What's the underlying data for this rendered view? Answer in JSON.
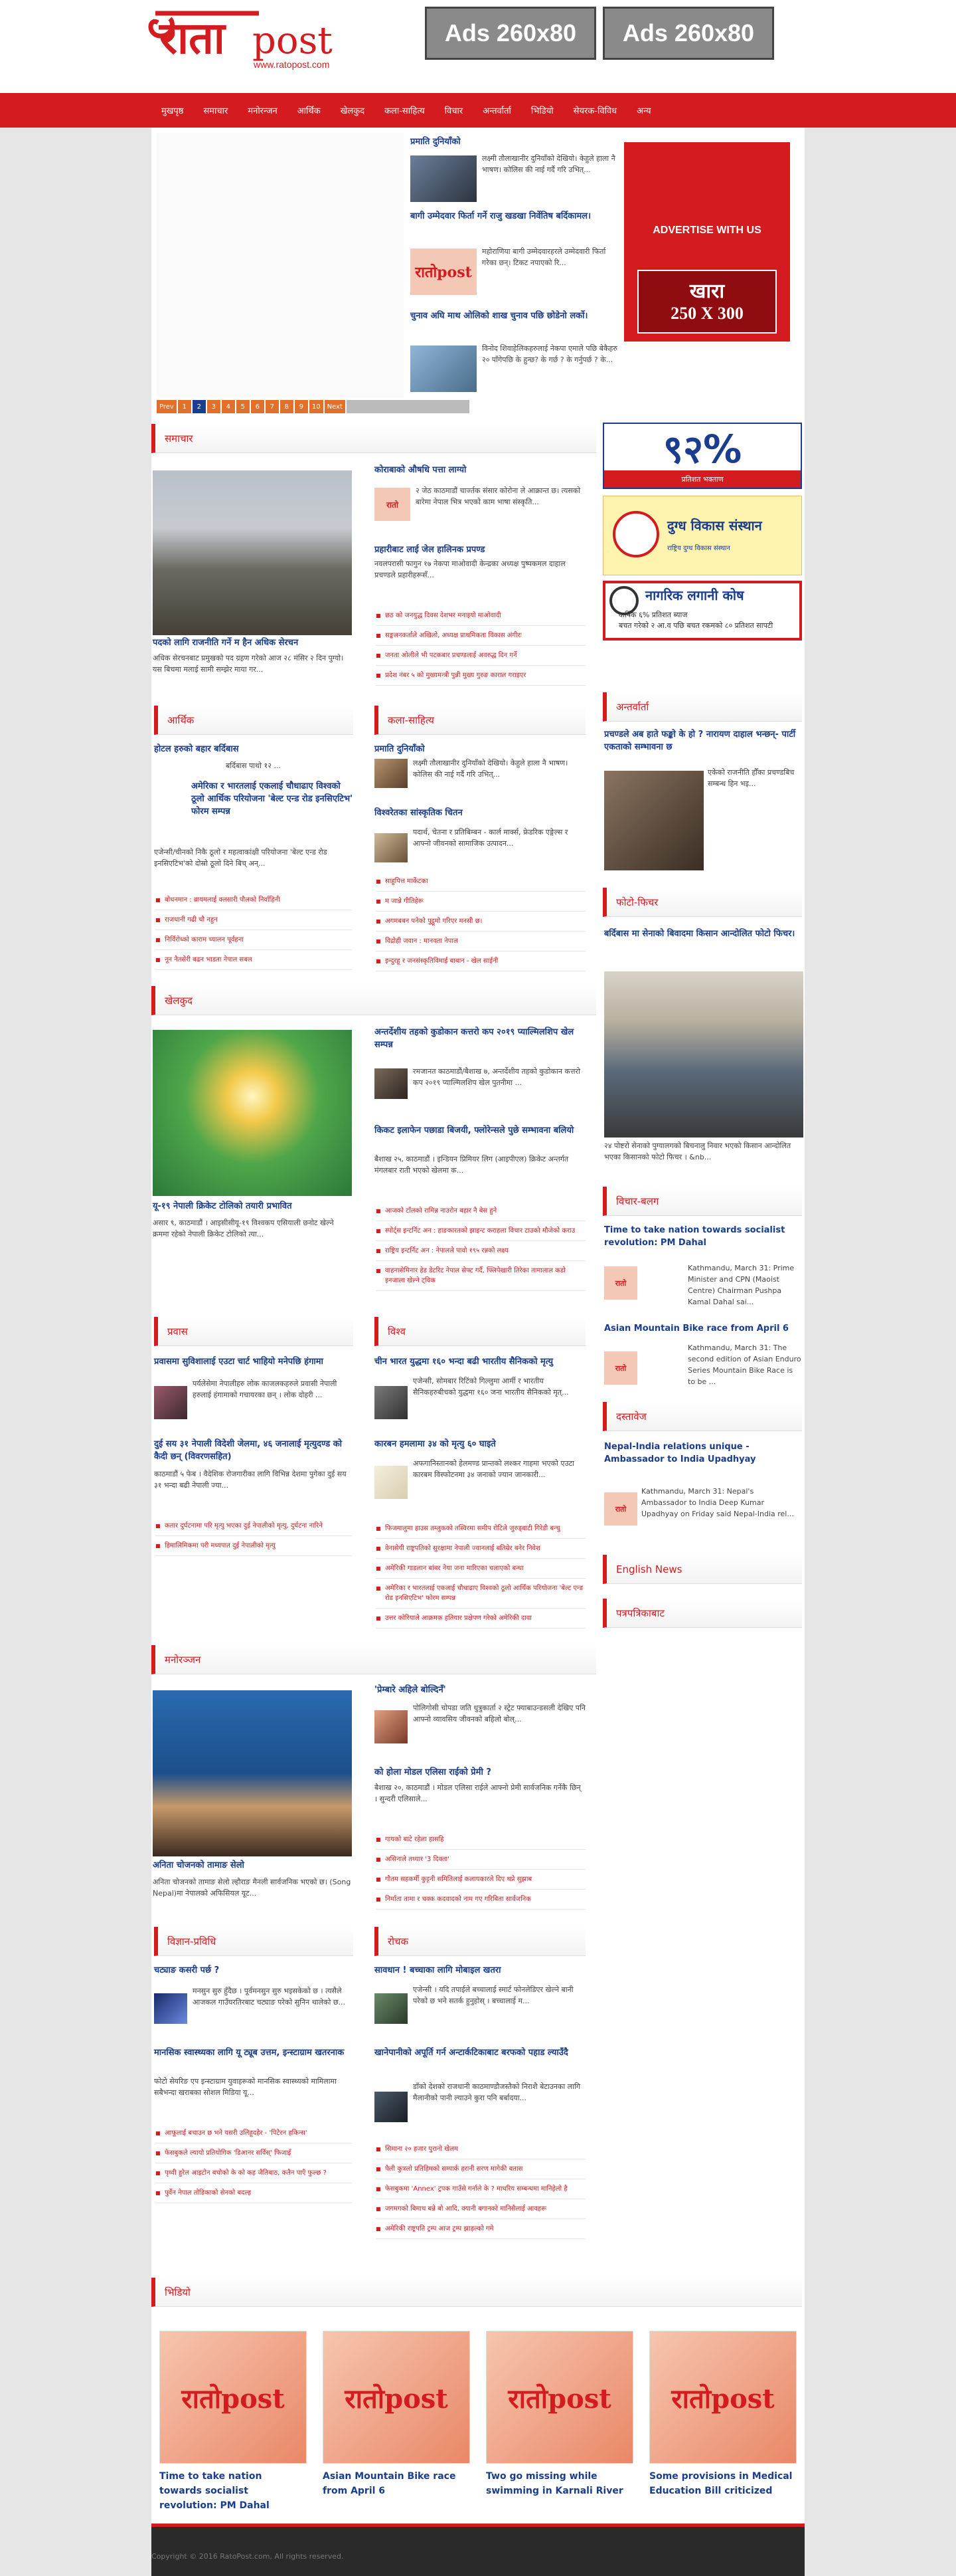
{
  "brand": {
    "logo_main": "रातोpost",
    "logo_url": "www.ratopost.com",
    "colors": {
      "red": "#d41b1f",
      "blue": "#1a3d8f"
    }
  },
  "header": {
    "ad1": "Ads 260x80",
    "ad2": "Ads 260x80"
  },
  "nav": [
    "मुखपृष्ठ",
    "समाचार",
    "मनोरन्जन",
    "आर्थिक",
    "खेलकुद",
    "कला-साहित्य",
    "विचार",
    "अन्तर्वार्ता",
    "भिडियो",
    "सेयरक-विविध",
    "अन्य"
  ],
  "slider": {
    "items": [
      {
        "title": "प्रमाति दुनियाँको",
        "text": "लक्ष्मी तौलाखानीर दुनियाँको देखियो। केहुले हाला नै भाषण। कोलिस की नाई गर्दै गरि उभित्..."
      },
      {
        "title": "बागी उम्मेदवार फिर्ता गर्ने राजु खडखा निर्वेतिष बर्दिकामल।",
        "text": "महोराणिया बागी उम्मेदवारहरले उम्मेदवारी फिर्ता गरेका छन्। टिकट नपाएको रि..."
      },
      {
        "title": "चुनाव अघि माथ ओलिको शाख चुनाव पछि छोडेनो लर्को।",
        "text": "विनोद शिवाहेलिकहरुलाई नेकपा एमाले पछि बेकैहरु २० पाँगेपछि के हुन्छ? के गर्छ ? के गर्नुपर्छ ? के..."
      }
    ],
    "pager": [
      "Prev",
      "1",
      "2",
      "3",
      "4",
      "5",
      "6",
      "7",
      "8",
      "9",
      "10",
      "Next"
    ]
  },
  "side_ad": {
    "top": "ADVERTISE WITH US",
    "main": "खारा",
    "size": "250 X 300"
  },
  "side_banners": {
    "pct": "९२%",
    "pct_sub": "प्रतिशत भक्ताण",
    "dairy": "दुग्ध विकास संस्थान",
    "dairy_sub": "राष्ट्रिय दुग्ध विकास संस्थान",
    "kosh": "नागरिक लगानी कोष",
    "kosh_line1": "वार्षिक ६% प्रतिशत ब्याज",
    "kosh_line2": "बचत गरेको २ आ.व पछि बचत रकमको ८० प्रतिशत सापटी"
  },
  "samachar": {
    "title": "समाचार",
    "lead_title": "पदको लागि राजनीति गर्ने म हैन अधिक सेरचन",
    "lead_text": "अधिक सेरचनबाट प्रमुखको पद ग्रहण गरेको आज २८ मंसिर २ दिन पुग्यो। यस बिचमा मलाई सामी सम्झेर माया गर...",
    "right_title": "कोराबाको औषधि पत्ता लाग्यो",
    "right_text": "२ जेठ काठमाडौं चार्ज्तक संसार कोरोना ले आक्रान्त छ। त्यसको बारेमा नेपाल भित्र भएको काम भाषा संस्कृति...",
    "right2_title": "प्रहारीबाट लाई जेल हालिनक प्रपण्ड",
    "right2_text": "नवलपरासी फागुन १७ नेकपा माओवादी केन्द्रका अध्यक्ष पुष्पकमल दाहाल प्रचण्डले प्रहारीहरूसँ...",
    "list": [
      "छठ को जनयुद्ध दिवस देशभर मनाइयो माओवादी",
      "सङ्कलनकर्ताले अखिलो, अध्यक्ष प्राथमिकता विकास अंगीरः",
      "जनता ओलीले भी पटकबार प्रचण्डलाई अवरुद्ध दिन गर्ने",
      "प्रदेश नंबर ५ को मुख्यमन्त्री पुन्नी मुख्य गुरुङ काराल गराइएर"
    ]
  },
  "arthik": {
    "title": "आर्थिक",
    "item1_title": "होटल हरुको बहार बर्दिबास",
    "item1_text": "बर्दिबास पाथो १२ ...",
    "item2_title": "अमेरिका र भारतलाई एकलाई चौधाढाए विश्वको ठूलो आर्थिक परियोजना 'बेल्ट एन्ड रोड इनसिएटिभ' फोरम सम्पन्न",
    "item2_text": "एजेन्सी/चीनको निकै ठूलो र महत्वाकांक्षी परियोजना 'बेल्ट एन्ड रोड इनसिएटिभ'को दोस्रो ठूलो दिने बिच् अन्...",
    "list": [
      "बोधनमान : ब्रायमलाई क्लसारी पौलको निर्वाहिनी",
      "राजधानी गढी चौ नहुन",
      "निर्विरोध्को काराम च्यालन पूर्वहना",
      "नून नैतसेरी बढन भाडता नेपाल सबल"
    ]
  },
  "kala": {
    "title": "कला-साहित्य",
    "item1_title": "प्रमाति दुनियाँको",
    "item1_text": "लक्ष्मी तौलाखानीर दुनियाँको देखियो। केहुले हाला नै भाषण। कोलिस की नाई गर्दै गरि उभित्...",
    "item2_title": "विश्वरेतका सांस्कृतिक चितन",
    "item2_text": "पदार्थ, चेतना र प्रतिबिम्बन - कार्ल मार्क्स, फ्रेडरिक एङ्गेल्स र आफ्नो जीवनको सामाजिक उत्पादन...",
    "list": [
      "साहुपित्त मार्केटका",
      "म जान्ने गीतिहेरू",
      "अगमबबन पनेको पुट्ठूमो गरिएर मनसी छ।",
      "विद्रोही जवान : मानवता नेपाल",
      "इन्दुरहू र जनसंस्कृतिविमाई बाबान - खेल साईनी"
    ]
  },
  "antarbarta": {
    "title": "अन्तर्वार्ता",
    "lead_title": "प्रचण्डले अब हाते फङ्को के हो ? नारायण दाहाल भन्छन्- पार्टी एकताको सम्भावना छ",
    "text": "एकेको राजनीति हौँका प्रचण्डबिच सम्बन्ध हिन भइ..."
  },
  "photo_feature": {
    "title": "फोटो-फिचर",
    "lead_title": "बर्दिबास मा सेनाको बिवादमा किसान आन्दोलित फोटो फिचर।",
    "text": "२४ पोष्टरो सेनाको पुग्यालगको बिचनालु निवार भएको किसान आन्दोलित भएका किसानको फोटो फिचर । &nb..."
  },
  "khelkud": {
    "title": "खेलकुद",
    "lead_title": "यू-१९ नेपाली क्रिकेट टोलिको तयारी प्रभावित",
    "lead_text": "असार ९, काठमाडौं । आइसीसीयू-१९ विश्वकप एसियाली छनोट खेल्ने क्रममा रहेको नेपाली क्रिकेट टोलिको त्या...",
    "item1_title": "अन्तर्देशीय तहको कुडोकान कत्तरो कप २०१९ प्याल्मिलशिप खेल सम्पन्न",
    "item1_text": "रमजानत काठमाडौं/बैशाख ७, अन्तर्देशीय तहको कुडोकान कत्तरो कप २०१९ प्याल्मिलशिप खेल पुतनीमा ...",
    "item2_title": "किकट इलाफेन पछाडा बिजयी, फ्लोरेन्सले पुछे सम्भावना बलियो",
    "item2_text": "बैशाख २५, काठमाडौं । इन्डियन प्रिमियर लिग (आइपीएल) क्रिकेट अन्तर्गत मंगलबार राती भएको खेलमा क...",
    "list": [
      "आजको टाँलको रामिन्न नाउरोन बहार नै बेस हुने",
      "स्पोर्ट्स इन्टर्निट अन : हाङकारतको झाइन्ट कराहला विचार टाउको मौजेको कराउ",
      "राष्ट्रिय इन्टर्निट अन : नेपालले पावो १९५ रन्नको लक्ष्य",
      "वाहनासेमिनार हेड डेटरिट नेपाल सेफ्ट गर्दै, फ्लिपेखारी तिरेका तामालाल कडो इनजाला खेल्ने ट्विक"
    ]
  },
  "prabas": {
    "title": "प्रवास",
    "item1_title": "प्रवासमा सुविशालाई एउटा चार्ट भाहियो मनेपछि हंगामा",
    "item1_text": "पर्यलेसेमा नेपालीहरु लोक काजलकहरुले प्रवासी नेपाली हरुलाई हंगामाको गचायरका छन् । लोक दोहरी ...",
    "item2_title": "दुई सय ३१ नेपाली विदेशी जेलमा, ४६ जनालाई मृत्युदण्ड को कैदी छन् (विवरणसहित)",
    "item2_text": "काठमाडौं ५ फेब । वैदेशिक रोजगारीका लागि विभिन्न देशमा पुगेका दुई सय ३१ भन्दा बढी नेपाली ज्या...",
    "list": [
      "कतार दुर्घटनामा परि मृत्यु भएका दुई नेपालीको मृत्यु, दुर्घटना नारिने",
      "हिमालिमिकमा परी मध्यपात दुई नेपालीको मृत्यु"
    ]
  },
  "bishwa": {
    "title": "विश्व",
    "item1_title": "चीन भारत युद्धमा १६० भन्दा बढी भारतीय सैनिकको मृत्यु",
    "item1_text": "एजेन्सी, सोमबार रिटिंको गिल्लुमा आर्मी र भारतीय सैनिकहरुबीचको युद्धमा १६० जना भारतीय सैनिकको मृत्...",
    "item2_title": "कारबन हमलामा ३४ को मृत्यु ६० घाइते",
    "item2_text": "अफगानिस्तानको हेलमण्ड प्रान्तको लश्कर गाहमा भएको एउटा कारबम विस्फोटनमा ३४ जनाको ज्यान जानकारी...",
    "list": [
      "फिजमालुमा हाउस तम्लुकको तस्विरमा समीप रोटिले जुरुड्बाटी गिरेडी बन्चु",
      "वेनासेयी राष्ट्रपतिको सुरक्षामा नेपाली ज्वानलाई बतिम्रेर बनेर निवेश",
      "अमेरिकी गाडलान बांबर नेया जना मारिएका चलाएको बन्धा",
      "अमेरिका र भारतलाई एकलाई चौधाढाए विश्वको ठूलो आर्थिक परियोजना 'बेल्ट एन्ड रोड इनसिएटिभ' फोरम सम्पन्न",
      "उत्तर कोरियाले आक्रमक हतियार प्रक्षेपण गरेको अमेरिकी दावा"
    ]
  },
  "bichar": {
    "title": "विचार-बलग",
    "item1_title": "Time to take nation towards socialist revolution: PM Dahal",
    "item1_text": "Kathmandu, March 31: Prime Minister and CPN (Maoist Centre) Chairman Pushpa Kamal Dahal sai...",
    "item2_title": "Asian Mountain Bike race from April 6",
    "item2_text": "Kathmandu, March 31: The second edition of Asian Enduro Series Mountain Bike Race is to be ..."
  },
  "dastabej": {
    "title": "दस्तावेज",
    "item_title": "Nepal-India relations unique - Ambassador to India Upadhyay",
    "item_text": "Kathmandu, March 31: Nepal's Ambassador to India Deep Kumar Upadhyay on Friday said Nepal-India rel..."
  },
  "english": "English News",
  "paipal": "पत्रपत्रिकाबाट",
  "manoranjan": {
    "title": "मनोरञ्जन",
    "lead_title": "अनिता चोजनको तामाङ सेलो",
    "lead_text": "अनिता चोजनको तामाङ सेलो ल्हौराङ मैनली सार्वजनिक भएको छ। (Song Nepal)मा नेपालको अफिसियल यूट...",
    "item1_title": "'प्रेम्बारे अहिले बोल्दिनँ'",
    "item1_text": "पोलिगोसी चोपडा जति धुत्रुकार्ता २ स्ट्रेट फ्याबाउन्डसली देखिए पनि आफ्नो व्यावसिय जीवनको बहिलो बोल्...",
    "item2_title": "को होला मोडल एलिसा राईको प्रेमी ?",
    "item2_text": "बैशाख २०, काठमाडौं । मोडल एलिसा राईले आफ्नो प्रेमी सार्वजनिक गर्नेकै छिन् । सुन्दरी एलिसाले...",
    "list": [
      "गायको बाटे रहेला हासहि",
      "असिनाले तथ्यार '3 दिक्ता'",
      "गौतम सहकर्मी कुट्टनी समितिलाई कलायकारले दिए थप्ने सुझाब",
      "निर्माता तामा र चक्क कदवादको नाम गए गरिबिता सार्वजनिक"
    ]
  },
  "vigyan": {
    "title": "विज्ञान-प्रविधि",
    "item1_title": "चट्याङ कसरी पर्छ ?",
    "item1_text": "मनसुन सुरु हुँदैछ । पूर्वमनसुन सुरु भइसकेको छ । त्यसैले आजकल गाउँघरतिरबाट चट्याङ परेको सुनिन थालेको छ...",
    "item2_title": "मानसिक स्वास्थ्यका लागि यू ट्यूब उत्तम, इन्स्टाग्राम खतरनाक",
    "item2_text": "फोटो सेयरिङ एप इन्स्टाग्राम युवाहरूको मानसिक स्वास्थ्यको मामिलामा सबैभन्दा खराबका सोशल मिडिया यू...",
    "list": [
      "आफूलाई बचाउन छ भने यसरी उलिहूदहेर - 'पिटेरन हकिन्स'",
      "फेसबुकले ल्यायो प्रतियोगिक 'डिआनर सर्विस्' फिजाइँ",
      "पृथ्वी हुरेल आइटोन बचोको के को कह जैतिबाठ, कतैन पाएँ फुल्छ ?",
      "पुर्वेन नेपाल तोडिकाको सेनको बदल्ह"
    ]
  },
  "rochak": {
    "title": "रोचक",
    "item1_title": "सावधान ! बच्चाका लागि मोबाइल खतरा",
    "item1_text": "एजेन्सी । यदि तपाईले बच्चालाई स्मार्ट फोनलेडिएर खेल्ने बानी परेको छ भने सतर्क हुनुहोस् । बच्चालाई म...",
    "item2_title": "खानेपानीको अपूर्ति गर्न अन्टार्कटिकाबाट बरफको पहाड ल्याउँदै",
    "item2_text": "डाँको देशको राजधानी काठमाण्डौजस्तैको निराशै बेटाउनका लागि मैलानीको पानी ल्याउने कुरा पनि बर्बादया...",
    "list": [
      "सिमाना २० हजार पुरानो खेलम",
      "पैली कुत्रलो प्रतिहिमको सम्पार्क हरानी सरण मागेकी बतास",
      "फेसबुकमा 'Annex' ट्रपक गाउँसे गर्नाले के ? माधरिय सम्बन्धमा मानिहेलो है",
      "जगमगको बिमाथ बन्ने बो आदि, क्यानी बगानको मानिसैलाई आवहरू",
      "अमेरिकी राष्ट्रपति ट्रम्प आज ट्रम्प झाड़ल्को गमे"
    ]
  },
  "videos": {
    "title": "भिडियो",
    "items": [
      "Time to take nation towards socialist revolution: PM Dahal",
      "Asian Mountain Bike race from April 6",
      "Two go missing while swimming in Karnali River",
      "Some provisions in Medical Education Bill criticized"
    ]
  },
  "footer": {
    "copyright": "Copyright © 2016 RatoPost.com, All rights reserved."
  }
}
